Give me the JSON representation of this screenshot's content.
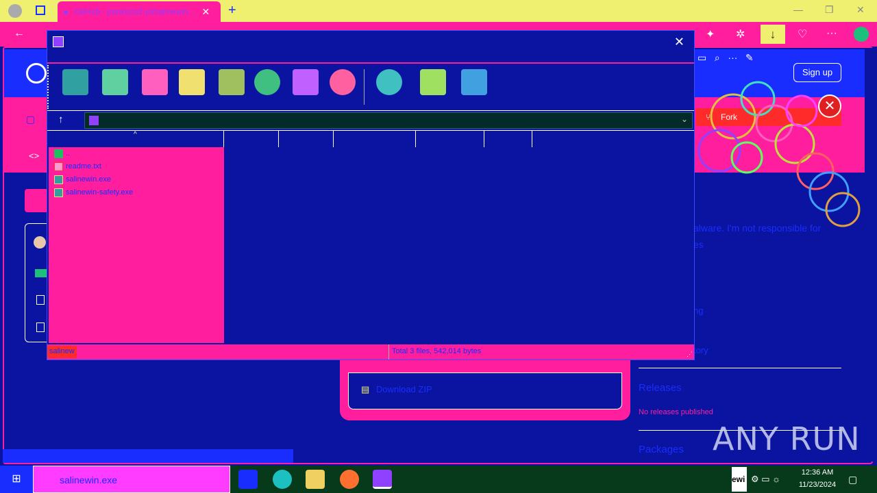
{
  "browser": {
    "tab_title": "GitHub - pankoza2-pl/salinewin...",
    "sign_up": "Sign up",
    "fork_label": "Fork"
  },
  "page": {
    "description_fragment": "alware. I'm not responsible for",
    "description_fragment2": "es",
    "side_1": "ng",
    "side_2": "tory",
    "releases_heading": "Releases",
    "no_releases": "No releases published",
    "packages_heading": "Packages",
    "download_zip": "Download ZIP"
  },
  "rar": {
    "files": [
      {
        "name": "..",
        "type": "folder-up"
      },
      {
        "name": "readme.txt",
        "type": "text"
      },
      {
        "name": "salinewin.exe",
        "type": "exe"
      },
      {
        "name": "salinewin-safety.exe",
        "type": "exe"
      }
    ],
    "status_left": "salinew",
    "status_right": "Total 3 files, 542,014 bytes"
  },
  "taskbar": {
    "search_text": "salinewin.exe",
    "time": "12:36 AM",
    "date": "11/23/2024",
    "tray_label": "ewi"
  },
  "watermark": "ANY RUN"
}
